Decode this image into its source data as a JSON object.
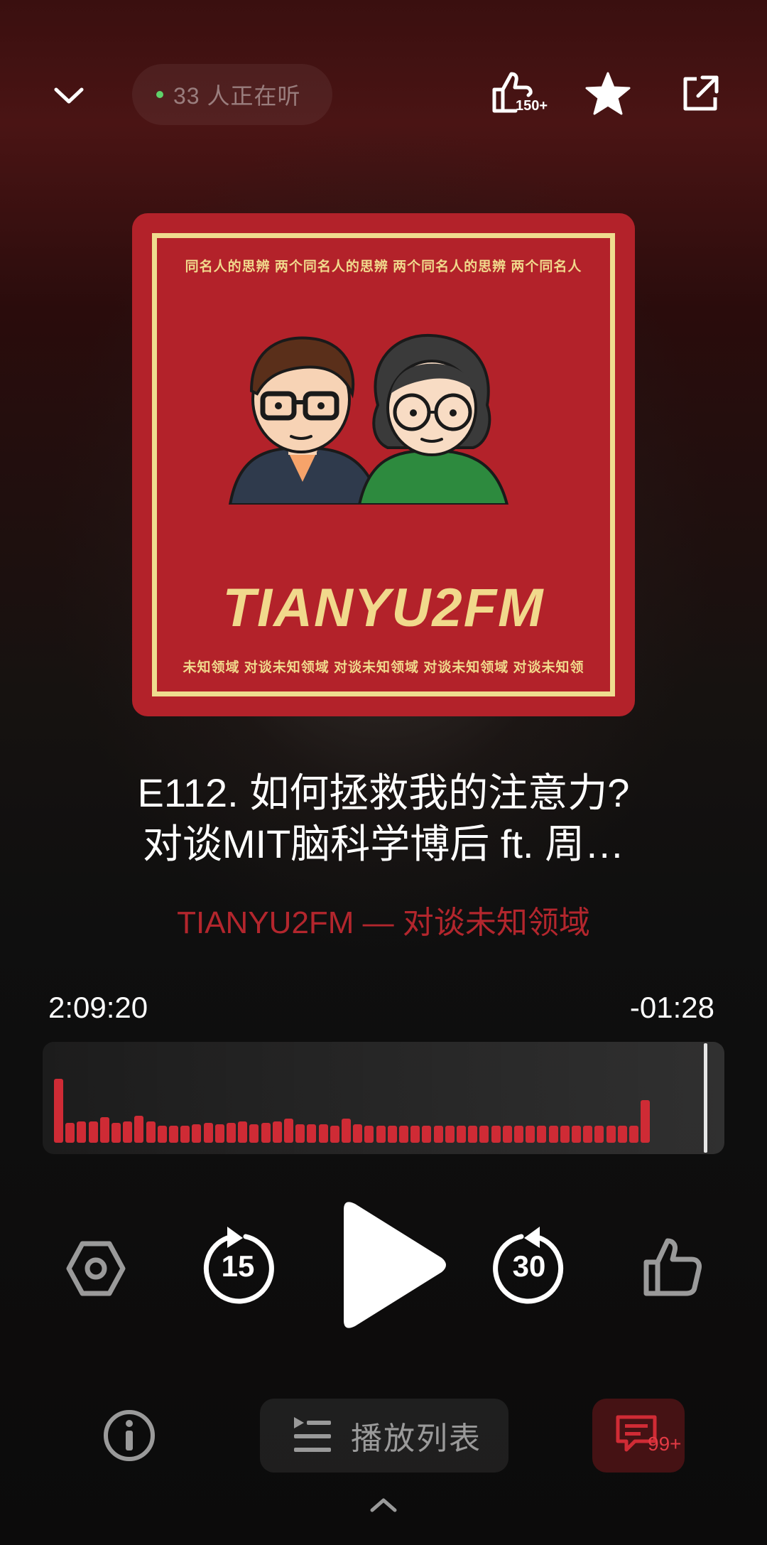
{
  "header": {
    "listeners_text": "33 人正在听",
    "like_count": "150+"
  },
  "cover": {
    "top_text": "同名人的思辨  两个同名人的思辨  两个同名人的思辨  两个同名人",
    "brand": "TIANYU2FM",
    "bottom_text": "未知领域  对谈未知领域  对谈未知领域  对谈未知领域  对谈未知领"
  },
  "episode": {
    "title_line1": "E112. 如何拯救我的注意力?",
    "title_line2": "对谈MIT脑科学博后 ft. 周…",
    "show": "TIANYU2FM — 对谈未知领域"
  },
  "progress": {
    "elapsed": "2:09:20",
    "remaining": "-01:28",
    "played_fraction": 0.98
  },
  "controls": {
    "rewind_seconds": "15",
    "forward_seconds": "30"
  },
  "bottom": {
    "playlist_label": "播放列表",
    "comment_count": "99+"
  },
  "colors": {
    "accent": "#cf2b35",
    "show_name": "#b3262d",
    "cover_red": "#b3222a",
    "cover_cream": "#f1d98c"
  }
}
